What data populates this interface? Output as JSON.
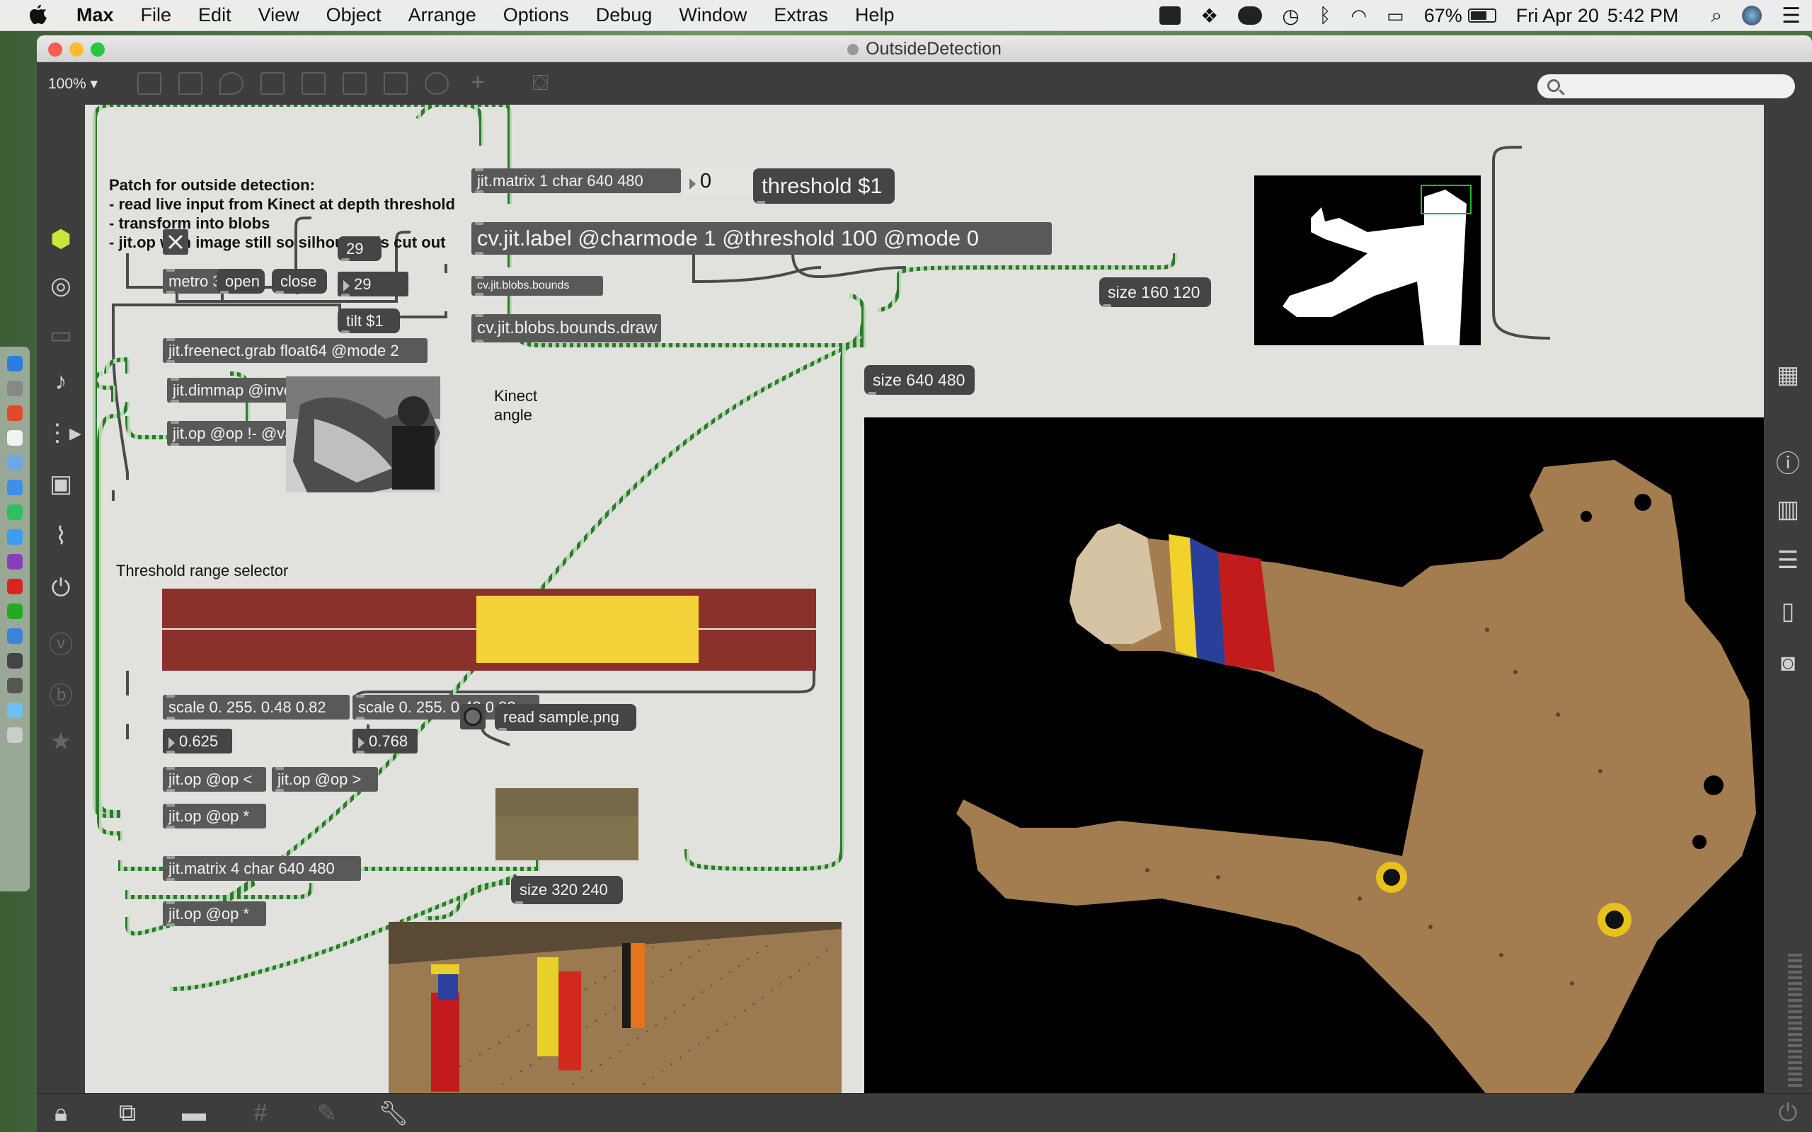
{
  "menubar": {
    "app": "Max",
    "menus": [
      "File",
      "Edit",
      "View",
      "Object",
      "Arrange",
      "Options",
      "Debug",
      "Window",
      "Extras",
      "Help"
    ],
    "battery": "67%",
    "date": "Fri Apr 20",
    "time": "5:42 PM"
  },
  "window": {
    "title": "OutsideDetection",
    "zoom": "100%"
  },
  "patch": {
    "comment_lines": [
      "Patch for outside detection:",
      "- read live input from Kinect at depth threshold",
      "- transform into blobs",
      "- jit.op with image still so silhouette is cut out"
    ],
    "kinect_label": "Kinect\nangle",
    "threshold_label": "Threshold range selector",
    "slider": {
      "low": 0.48,
      "high": 0.82,
      "bg_color": "#8a312b",
      "fill_color": "#f5d13a"
    },
    "objects": {
      "metro": "metro 33",
      "open": "open",
      "close": "close",
      "num29a": "29",
      "num29b": "29",
      "tilt": "tilt $1",
      "freenect": "jit.freenect.grab float64 @mode 2",
      "dimmap": "jit.dimmap @invert -1",
      "op_rminus": "jit.op @op !- @val 1",
      "matrix1": "jit.matrix 1 char 640 480",
      "num0": "0",
      "threshold_msg": "threshold $1",
      "label": "cv.jit.label @charmode 1 @threshold 100 @mode 0",
      "blobs_bounds": "cv.jit.blobs.bounds",
      "blobs_draw": "cv.jit.blobs.bounds.draw",
      "size160": "size 160 120",
      "size640": "size 640 480",
      "scale1": "scale 0. 255. 0.48 0.82",
      "scale2": "scale 0. 255. 0.48 0.82",
      "f625": "0.625",
      "f768": "0.768",
      "read_sample": "read sample.png",
      "op_lt": "jit.op @op <",
      "op_gt": "jit.op @op >",
      "op_mul1": "jit.op @op *",
      "matrix4": "jit.matrix 4 char 640 480",
      "op_mul2": "jit.op @op *",
      "size320": "size 320 240"
    }
  }
}
